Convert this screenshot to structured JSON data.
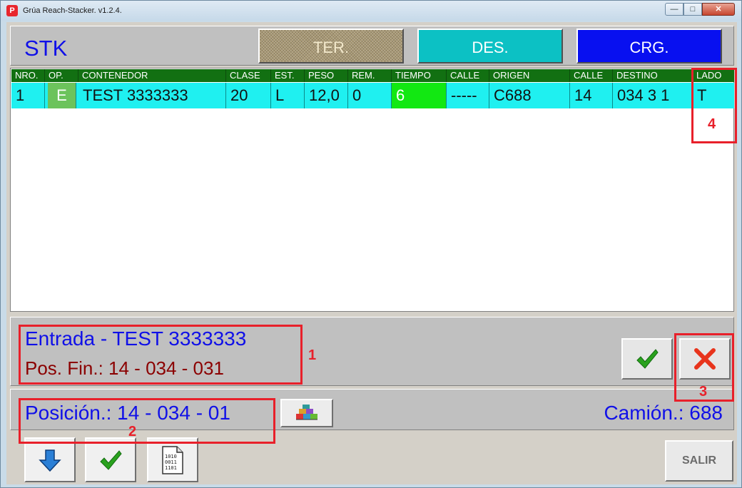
{
  "window": {
    "title": "Grúa Reach-Stacker. v1.2.4.",
    "controls": {
      "minimize": "—",
      "maximize": "□",
      "close": "✕"
    }
  },
  "topbar": {
    "label": "STK",
    "buttons": {
      "ter": "TER.",
      "des": "DES.",
      "crg": "CRG."
    }
  },
  "grid": {
    "columns": [
      "NRO.",
      "OP.",
      "CONTENEDOR",
      "CLASE",
      "EST.",
      "PESO",
      "REM.",
      "TIEMPO",
      "CALLE",
      "ORIGEN",
      "CALLE",
      "DESTINO",
      "LADO"
    ],
    "rows": [
      [
        "1",
        "E",
        "TEST 3333333",
        "20",
        "L",
        "12,0",
        "0",
        "6",
        "-----",
        "C688",
        "14",
        "034 3 1",
        "T"
      ]
    ]
  },
  "info": {
    "line1": "Entrada - TEST 3333333",
    "line2": "Pos. Fin.: 14 - 034 - 031"
  },
  "position": {
    "text": "Posición.: 14 - 034 - 01",
    "truck": "Camión.: 688"
  },
  "toolbar": {
    "salir": "SALIR"
  },
  "annotations": [
    "1",
    "2",
    "3",
    "4"
  ],
  "colors": {
    "accent_blue": "#1010e8",
    "header_green": "#127012",
    "row_cyan": "#1ff0f0",
    "annotation_red": "#e8202a"
  }
}
